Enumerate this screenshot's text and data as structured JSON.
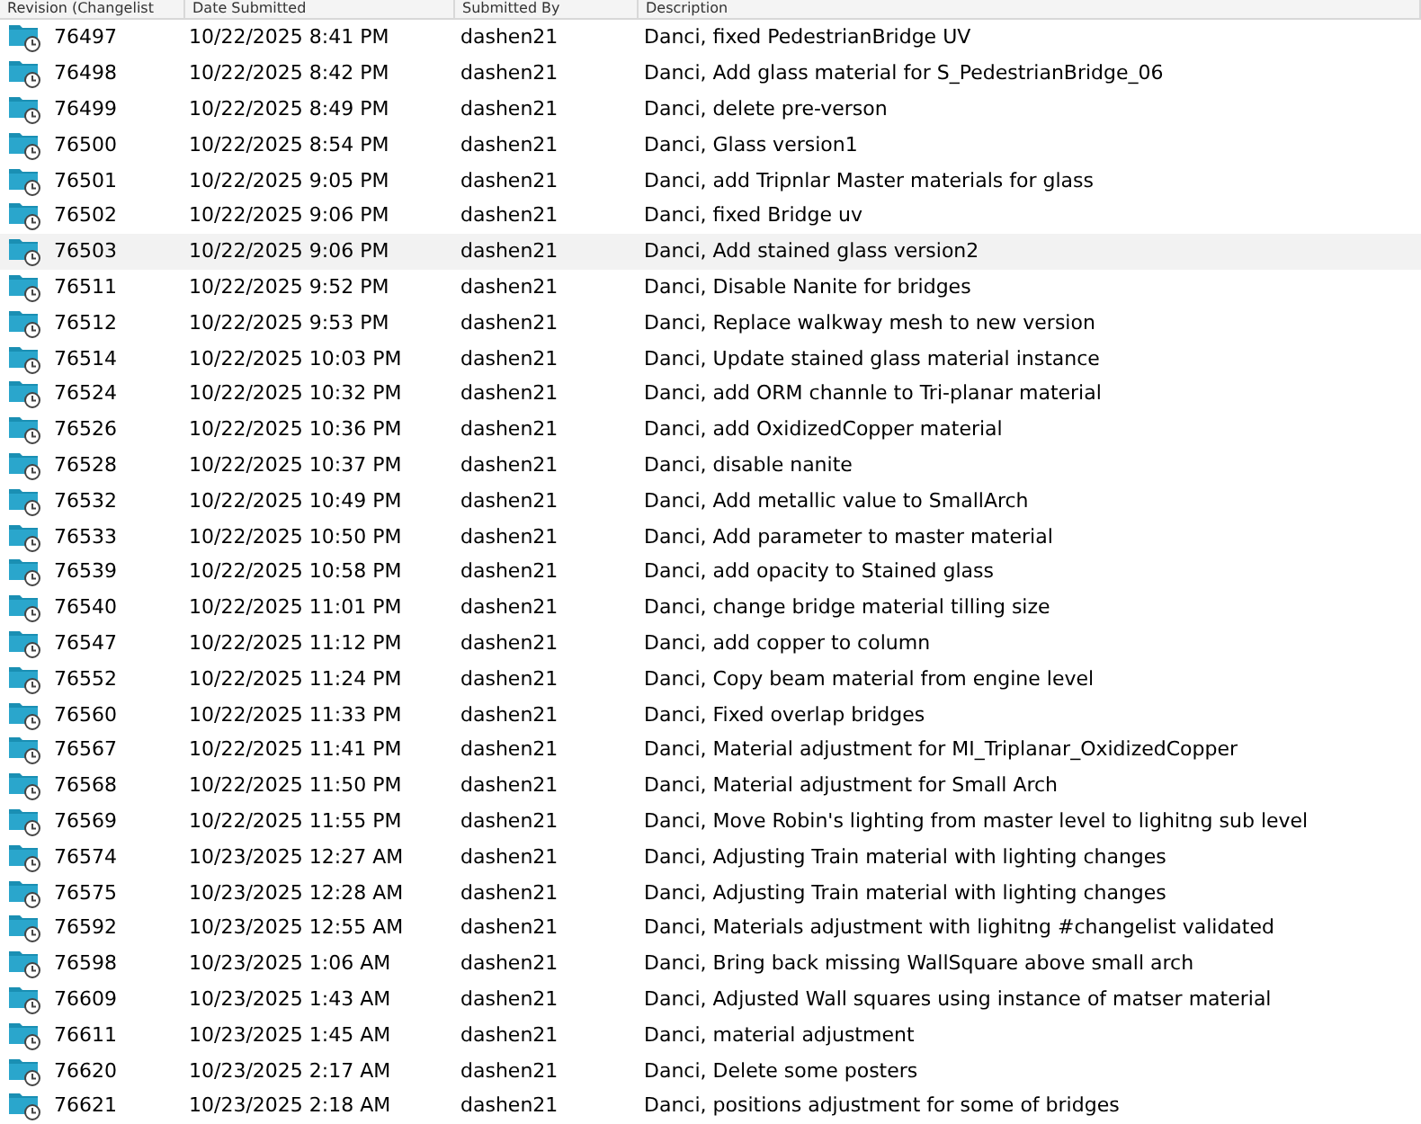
{
  "table": {
    "columns": [
      "Revision (Changelist",
      "Date Submitted",
      "Submitted By",
      "Description"
    ],
    "rows": [
      {
        "revision": "76497",
        "date": "10/22/2025 8:41 PM",
        "user": "dashen21",
        "description": "Danci, fixed PedestrianBridge UV",
        "selected": false
      },
      {
        "revision": "76498",
        "date": "10/22/2025 8:42 PM",
        "user": "dashen21",
        "description": "Danci, Add glass material for S_PedestrianBridge_06",
        "selected": false
      },
      {
        "revision": "76499",
        "date": "10/22/2025 8:49 PM",
        "user": "dashen21",
        "description": "Danci, delete pre-verson",
        "selected": false
      },
      {
        "revision": "76500",
        "date": "10/22/2025 8:54 PM",
        "user": "dashen21",
        "description": "Danci, Glass version1",
        "selected": false
      },
      {
        "revision": "76501",
        "date": "10/22/2025 9:05 PM",
        "user": "dashen21",
        "description": "Danci, add Tripnlar Master materials for glass",
        "selected": false
      },
      {
        "revision": "76502",
        "date": "10/22/2025 9:06 PM",
        "user": "dashen21",
        "description": "Danci, fixed Bridge uv",
        "selected": false
      },
      {
        "revision": "76503",
        "date": "10/22/2025 9:06 PM",
        "user": "dashen21",
        "description": "Danci, Add stained glass version2",
        "selected": true
      },
      {
        "revision": "76511",
        "date": "10/22/2025 9:52 PM",
        "user": "dashen21",
        "description": "Danci, Disable Nanite for bridges",
        "selected": false
      },
      {
        "revision": "76512",
        "date": "10/22/2025 9:53 PM",
        "user": "dashen21",
        "description": "Danci, Replace walkway mesh to new version",
        "selected": false
      },
      {
        "revision": "76514",
        "date": "10/22/2025 10:03 PM",
        "user": "dashen21",
        "description": "Danci, Update stained glass material instance",
        "selected": false
      },
      {
        "revision": "76524",
        "date": "10/22/2025 10:32 PM",
        "user": "dashen21",
        "description": "Danci, add ORM channle to Tri-planar material",
        "selected": false
      },
      {
        "revision": "76526",
        "date": "10/22/2025 10:36 PM",
        "user": "dashen21",
        "description": "Danci, add OxidizedCopper material",
        "selected": false
      },
      {
        "revision": "76528",
        "date": "10/22/2025 10:37 PM",
        "user": "dashen21",
        "description": "Danci, disable nanite",
        "selected": false
      },
      {
        "revision": "76532",
        "date": "10/22/2025 10:49 PM",
        "user": "dashen21",
        "description": "Danci, Add metallic value to SmallArch",
        "selected": false
      },
      {
        "revision": "76533",
        "date": "10/22/2025 10:50 PM",
        "user": "dashen21",
        "description": "Danci, Add parameter to master material",
        "selected": false
      },
      {
        "revision": "76539",
        "date": "10/22/2025 10:58 PM",
        "user": "dashen21",
        "description": "Danci, add opacity to Stained glass",
        "selected": false
      },
      {
        "revision": "76540",
        "date": "10/22/2025 11:01 PM",
        "user": "dashen21",
        "description": "Danci, change bridge material tilling size",
        "selected": false
      },
      {
        "revision": "76547",
        "date": "10/22/2025 11:12 PM",
        "user": "dashen21",
        "description": "Danci, add copper to column",
        "selected": false
      },
      {
        "revision": "76552",
        "date": "10/22/2025 11:24 PM",
        "user": "dashen21",
        "description": "Danci, Copy beam material from engine level",
        "selected": false
      },
      {
        "revision": "76560",
        "date": "10/22/2025 11:33 PM",
        "user": "dashen21",
        "description": "Danci, Fixed overlap bridges",
        "selected": false
      },
      {
        "revision": "76567",
        "date": "10/22/2025 11:41 PM",
        "user": "dashen21",
        "description": "Danci, Material adjustment for MI_Triplanar_OxidizedCopper",
        "selected": false
      },
      {
        "revision": "76568",
        "date": "10/22/2025 11:50 PM",
        "user": "dashen21",
        "description": "Danci, Material adjustment for Small Arch",
        "selected": false
      },
      {
        "revision": "76569",
        "date": "10/22/2025 11:55 PM",
        "user": "dashen21",
        "description": "Danci, Move Robin's lighting from master level to lighitng sub level",
        "selected": false
      },
      {
        "revision": "76574",
        "date": "10/23/2025 12:27 AM",
        "user": "dashen21",
        "description": "Danci, Adjusting Train material with lighting changes",
        "selected": false
      },
      {
        "revision": "76575",
        "date": "10/23/2025 12:28 AM",
        "user": "dashen21",
        "description": "Danci, Adjusting Train material with lighting changes",
        "selected": false
      },
      {
        "revision": "76592",
        "date": "10/23/2025 12:55 AM",
        "user": "dashen21",
        "description": "Danci, Materials adjustment with lighitng #changelist validated",
        "selected": false
      },
      {
        "revision": "76598",
        "date": "10/23/2025 1:06 AM",
        "user": "dashen21",
        "description": "Danci, Bring back missing WallSquare above small arch",
        "selected": false
      },
      {
        "revision": "76609",
        "date": "10/23/2025 1:43 AM",
        "user": "dashen21",
        "description": "Danci, Adjusted Wall squares using instance of matser material",
        "selected": false
      },
      {
        "revision": "76611",
        "date": "10/23/2025 1:45 AM",
        "user": "dashen21",
        "description": "Danci, material adjustment",
        "selected": false
      },
      {
        "revision": "76620",
        "date": "10/23/2025 2:17 AM",
        "user": "dashen21",
        "description": "Danci, Delete some posters",
        "selected": false
      },
      {
        "revision": "76621",
        "date": "10/23/2025 2:18 AM",
        "user": "dashen21",
        "description": "Danci, positions adjustment for some of bridges",
        "selected": false
      }
    ]
  }
}
